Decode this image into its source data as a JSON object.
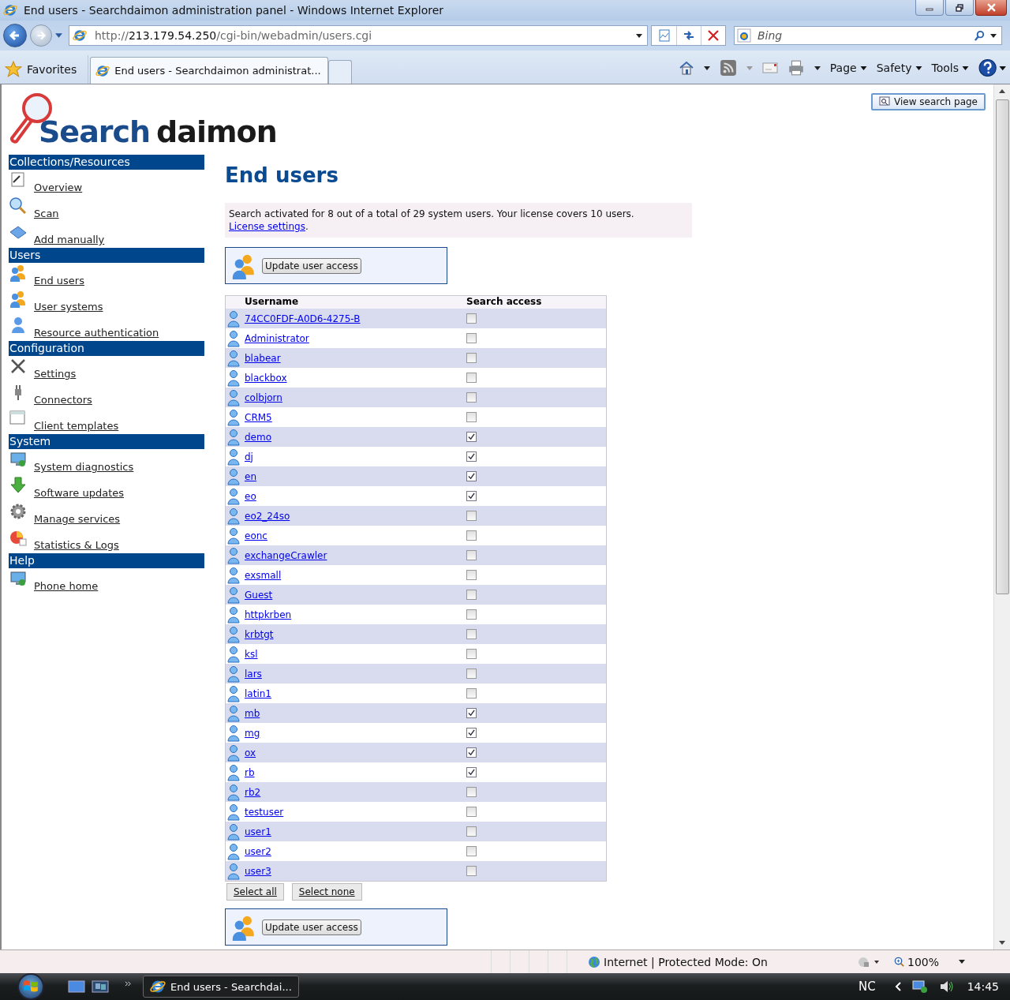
{
  "window": {
    "title": "End users - Searchdaimon administration panel - Windows Internet Explorer"
  },
  "address_bar": {
    "url_prefix": "http://",
    "url_host": "213.179.54.250",
    "url_path": "/cgi-bin/webadmin/users.cgi"
  },
  "search": {
    "placeholder": "Bing"
  },
  "favorites": "Favorites",
  "tabs": [
    {
      "label": "End users - Searchdaimon administrat...",
      "selected": true
    }
  ],
  "command_bar": [
    "Page",
    "Safety",
    "Tools"
  ],
  "page": {
    "view_search": "View search page",
    "logo": {
      "left": "Search",
      "right": "daimon"
    },
    "sidebar": [
      {
        "title": "Collections/Resources",
        "items": [
          "Overview",
          "Scan",
          "Add manually"
        ]
      },
      {
        "title": "Users",
        "items": [
          "End users",
          "User systems",
          "Resource authentication"
        ]
      },
      {
        "title": "Configuration",
        "items": [
          "Settings",
          "Connectors",
          "Client templates"
        ]
      },
      {
        "title": "System",
        "items": [
          "System diagnostics",
          "Software updates",
          "Manage services",
          "Statistics & Logs"
        ]
      },
      {
        "title": "Help",
        "items": [
          "Phone home"
        ]
      }
    ],
    "heading": "End users",
    "info": "Search activated for 8 out of a total of 29 system users. Your license covers 10 users.",
    "info_link": "License settings",
    "info_end": ".",
    "update_button": "Update user access",
    "update_button_bottom": "Update user access",
    "columns": [
      "Username",
      "Search access"
    ],
    "rows": [
      {
        "name": "74CC0FDF-A0D6-4275-B",
        "checked": false
      },
      {
        "name": "Administrator",
        "checked": false
      },
      {
        "name": "blabear",
        "checked": false
      },
      {
        "name": "blackbox",
        "checked": false
      },
      {
        "name": "colbjorn",
        "checked": false
      },
      {
        "name": "CRM5",
        "checked": false
      },
      {
        "name": "demo",
        "checked": true
      },
      {
        "name": "dj",
        "checked": true
      },
      {
        "name": "en",
        "checked": true
      },
      {
        "name": "eo",
        "checked": true
      },
      {
        "name": "eo2_24so",
        "checked": false
      },
      {
        "name": "eonc",
        "checked": false
      },
      {
        "name": "exchangeCrawler",
        "checked": false
      },
      {
        "name": "exsmall",
        "checked": false
      },
      {
        "name": "Guest",
        "checked": false
      },
      {
        "name": "httpkrben",
        "checked": false
      },
      {
        "name": "krbtgt",
        "checked": false
      },
      {
        "name": "ksl",
        "checked": false
      },
      {
        "name": "lars",
        "checked": false
      },
      {
        "name": "latin1",
        "checked": false
      },
      {
        "name": "mb",
        "checked": true
      },
      {
        "name": "mg",
        "checked": true
      },
      {
        "name": "ox",
        "checked": true
      },
      {
        "name": "rb",
        "checked": true
      },
      {
        "name": "rb2",
        "checked": false
      },
      {
        "name": "testuser",
        "checked": false
      },
      {
        "name": "user1",
        "checked": false
      },
      {
        "name": "user2",
        "checked": false
      },
      {
        "name": "user3",
        "checked": false
      }
    ],
    "select_all": "Select all",
    "select_none": "Select none"
  },
  "status_bar": {
    "zone": "Internet | Protected Mode: On",
    "zoom": "100%"
  },
  "taskbar": {
    "task": "End users - Searchdai...",
    "language": "NC",
    "clock": "14:45"
  }
}
